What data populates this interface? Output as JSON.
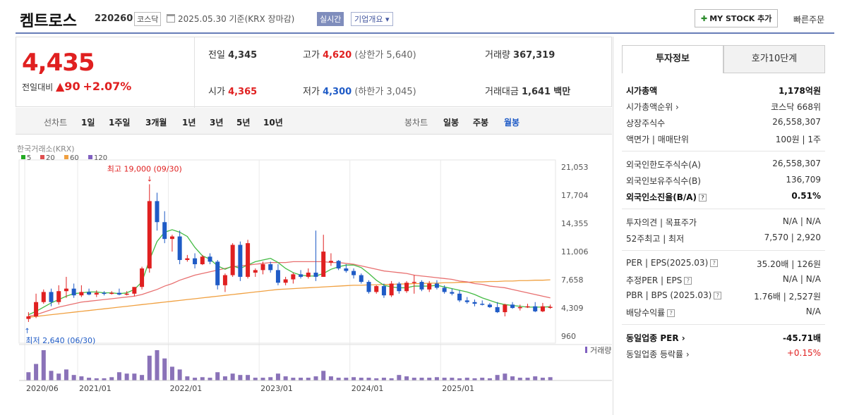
{
  "header": {
    "name": "켐트로스",
    "code": "220260",
    "market": "코스닥",
    "date_text": "2025.05.30 기준(KRX 장마감)",
    "live_label": "실시간",
    "info_label": "기업개요 ▾",
    "mystock_label": "MY STOCK 추가",
    "quick_label": "빠른주문"
  },
  "price": {
    "current": "4,435",
    "change_label": "전일대비",
    "change_value": "▲90",
    "change_pct": "+2.07%"
  },
  "quote": {
    "prev_label": "전일",
    "prev": "4,345",
    "high_label": "고가",
    "high": "4,620",
    "upper_limit": "(상한가 5,640)",
    "volume_label": "거래량",
    "volume": "367,319",
    "open_label": "시가",
    "open": "4,365",
    "low_label": "저가",
    "low": "4,300",
    "lower_limit": "(하한가 3,045)",
    "amount_label": "거래대금",
    "amount": "1,641",
    "amount_unit": "백만"
  },
  "rangebar": {
    "line_label": "선차트",
    "line_options": [
      "1일",
      "1주일",
      "3개월",
      "1년",
      "3년",
      "5년",
      "10년"
    ],
    "candle_label": "봉차트",
    "candle_options": [
      "일봉",
      "주봉",
      "월봉"
    ],
    "active_candle": "월봉"
  },
  "chart_data": {
    "type": "candlestick",
    "source": "한국거래소(KRX)",
    "legend": [
      {
        "name": "5",
        "color": "#22aa22"
      },
      {
        "name": "20",
        "color": "#e05050"
      },
      {
        "name": "60",
        "color": "#f0a040"
      },
      {
        "name": "120",
        "color": "#8060c0"
      }
    ],
    "y_ticks": [
      "21,053",
      "17,704",
      "14,355",
      "11,006",
      "7,658",
      "4,309",
      "960"
    ],
    "ylim": [
      960,
      21053
    ],
    "x_ticks": [
      "2020/06",
      "2021/01",
      "2022/01",
      "2023/01",
      "2024/01",
      "2025/01"
    ],
    "max_annotation": "최고 19,000 (09/30)",
    "min_annotation": "최저 2,640 (06/30)",
    "volume_label": "거래량",
    "candles": [
      [
        3000,
        2640,
        3800,
        3300
      ],
      [
        3300,
        3100,
        6000,
        5000
      ],
      [
        5000,
        4800,
        6500,
        6200
      ],
      [
        6200,
        4500,
        6600,
        5000
      ],
      [
        5000,
        4700,
        7000,
        6300
      ],
      [
        6300,
        5500,
        8000,
        6600
      ],
      [
        6600,
        5500,
        7200,
        5800
      ],
      [
        5800,
        5600,
        7000,
        6200
      ],
      [
        6200,
        5800,
        6600,
        5900
      ],
      [
        5900,
        5600,
        6400,
        6100
      ],
      [
        6100,
        5800,
        6300,
        6000
      ],
      [
        6000,
        5900,
        6300,
        6100
      ],
      [
        6100,
        5800,
        6600,
        5900
      ],
      [
        5900,
        5800,
        6300,
        6000
      ],
      [
        6000,
        5700,
        6500,
        6800
      ],
      [
        6800,
        6500,
        9200,
        9000
      ],
      [
        9000,
        8500,
        19000,
        17000
      ],
      [
        17000,
        13500,
        18000,
        14500
      ],
      [
        14500,
        12000,
        15800,
        12500
      ],
      [
        12500,
        11000,
        13000,
        12800
      ],
      [
        12800,
        9500,
        13500,
        10000
      ],
      [
        10000,
        9800,
        10600,
        10200
      ],
      [
        10200,
        9000,
        10800,
        9500
      ],
      [
        9500,
        9400,
        10600,
        10400
      ],
      [
        10400,
        9500,
        10800,
        9800
      ],
      [
        9800,
        6500,
        10000,
        7000
      ],
      [
        7000,
        6200,
        8400,
        8200
      ],
      [
        8200,
        8000,
        12000,
        11800
      ],
      [
        11800,
        7500,
        12200,
        8000
      ],
      [
        8000,
        7800,
        12400,
        12000
      ],
      [
        8500,
        8000,
        9000,
        8800
      ],
      [
        8800,
        8300,
        9800,
        9500
      ],
      [
        9500,
        8500,
        9800,
        8800
      ],
      [
        8800,
        7000,
        9500,
        7300
      ],
      [
        7300,
        7000,
        8000,
        7700
      ],
      [
        7700,
        7200,
        8500,
        8300
      ],
      [
        8300,
        7800,
        8800,
        8000
      ],
      [
        8000,
        7800,
        9000,
        8500
      ],
      [
        8500,
        7500,
        13500,
        8000
      ],
      [
        8000,
        8000,
        13000,
        11000
      ],
      [
        9700,
        9300,
        10800,
        9900
      ],
      [
        9900,
        8800,
        10000,
        9000
      ],
      [
        9000,
        8500,
        9500,
        8700
      ],
      [
        8700,
        7800,
        9000,
        8200
      ],
      [
        8200,
        7200,
        8400,
        7400
      ],
      [
        7400,
        6000,
        7600,
        6200
      ],
      [
        6200,
        6000,
        7000,
        6900
      ],
      [
        6900,
        5500,
        7200,
        5800
      ],
      [
        5800,
        5600,
        7500,
        7200
      ],
      [
        7200,
        6000,
        7400,
        6300
      ],
      [
        6300,
        6100,
        7500,
        7300
      ],
      [
        7300,
        6000,
        8200,
        7400
      ],
      [
        7400,
        6300,
        7600,
        6500
      ],
      [
        6500,
        6200,
        7500,
        7200
      ],
      [
        7200,
        6500,
        7600,
        6700
      ],
      [
        6700,
        6000,
        7000,
        6200
      ],
      [
        6200,
        5800,
        6600,
        6000
      ],
      [
        6000,
        5000,
        6400,
        5200
      ],
      [
        5200,
        4800,
        5600,
        5000
      ],
      [
        5000,
        4500,
        5300,
        4800
      ],
      [
        4800,
        4600,
        5200,
        4700
      ],
      [
        4700,
        4300,
        4900,
        4400
      ],
      [
        4400,
        3700,
        5000,
        3800
      ],
      [
        3800,
        3300,
        4800,
        4700
      ],
      [
        4700,
        4200,
        5000,
        4300
      ],
      [
        4300,
        4000,
        4700,
        4400
      ],
      [
        4400,
        4300,
        4800,
        4500
      ],
      [
        4500,
        3800,
        5000,
        3900
      ],
      [
        3900,
        3800,
        4900,
        4500
      ],
      [
        4400,
        4200,
        4700,
        4435
      ]
    ],
    "ma5": [
      3500,
      3900,
      4400,
      4900,
      5300,
      5700,
      6000,
      6100,
      6200,
      6200,
      6100,
      6100,
      6000,
      6100,
      6500,
      7400,
      10000,
      12200,
      13300,
      13600,
      13300,
      12800,
      11500,
      10500,
      10100,
      9300,
      8900,
      9300,
      9000,
      9400,
      9800,
      10000,
      10200,
      9700,
      9000,
      8500,
      8200,
      8100,
      8100,
      8400,
      8900,
      9200,
      9400,
      9400,
      9100,
      8400,
      7600,
      7000,
      6800,
      6700,
      6700,
      6900,
      6900,
      6900,
      7000,
      6800,
      6600,
      6400,
      6200,
      5900,
      5500,
      5200,
      4900,
      4700,
      4600,
      4500,
      4400,
      4400,
      4400,
      4450
    ],
    "ma20": [
      3300,
      3500,
      3800,
      4100,
      4400,
      4600,
      4800,
      5000,
      5100,
      5200,
      5300,
      5400,
      5500,
      5600,
      5700,
      5900,
      6200,
      6500,
      6900,
      7200,
      7600,
      7900,
      8200,
      8400,
      8600,
      8800,
      9000,
      9200,
      9300,
      9400,
      9500,
      9600,
      9700,
      9700,
      9700,
      9800,
      9800,
      9800,
      9800,
      9800,
      9700,
      9700,
      9600,
      9500,
      9300,
      9100,
      8900,
      8700,
      8600,
      8500,
      8400,
      8200,
      8100,
      8000,
      7900,
      7800,
      7700,
      7500,
      7400,
      7200,
      7100,
      6900,
      6800,
      6700,
      6500,
      6300,
      6100,
      5900,
      5700,
      5500
    ],
    "ma60": [
      3200,
      3300,
      3400,
      3500,
      3600,
      3700,
      3800,
      3900,
      4000,
      4100,
      4200,
      4300,
      4400,
      4500,
      4600,
      4700,
      4800,
      4900,
      5000,
      5100,
      5200,
      5300,
      5400,
      5500,
      5600,
      5700,
      5800,
      5900,
      6000,
      6100,
      6200,
      6300,
      6400,
      6500,
      6550,
      6600,
      6650,
      6700,
      6750,
      6800,
      6850,
      6900,
      6950,
      7000,
      7000,
      7050,
      7050,
      7100,
      7100,
      7150,
      7150,
      7200,
      7200,
      7250,
      7250,
      7300,
      7300,
      7350,
      7350,
      7400,
      7400,
      7450,
      7450,
      7500,
      7500,
      7550,
      7550,
      7600,
      7600,
      7650
    ],
    "volume": [
      30,
      60,
      110,
      35,
      25,
      40,
      20,
      15,
      10,
      8,
      8,
      12,
      30,
      25,
      25,
      20,
      90,
      110,
      80,
      50,
      40,
      15,
      10,
      12,
      10,
      30,
      15,
      25,
      20,
      20,
      10,
      10,
      12,
      25,
      15,
      10,
      10,
      10,
      15,
      35,
      15,
      10,
      10,
      12,
      10,
      10,
      8,
      10,
      8,
      20,
      15,
      10,
      10,
      10,
      12,
      10,
      10,
      8,
      10,
      8,
      10,
      8,
      20,
      25,
      15,
      10,
      10,
      15,
      10,
      12
    ]
  },
  "side": {
    "tab_active": "투자정보",
    "tab_other": "호가10단계",
    "rows_a": [
      {
        "k": "시가총액",
        "v": "1,178억원",
        "bold": true
      },
      {
        "k": "시가총액순위 ›",
        "v": "코스닥 668위"
      },
      {
        "k": "상장주식수",
        "v": "26,558,307"
      },
      {
        "k": "액면가 | 매매단위",
        "v": "100원 | 1주"
      }
    ],
    "rows_b": [
      {
        "k": "외국인한도주식수(A)",
        "v": "26,558,307"
      },
      {
        "k": "외국인보유주식수(B)",
        "v": "136,709"
      },
      {
        "k": "외국인소진율(B/A)",
        "v": "0.51%",
        "bold": true,
        "q": true
      }
    ],
    "rows_c": [
      {
        "k": "투자의견 | 목표주가",
        "v": "N/A | N/A"
      },
      {
        "k": "52주최고 | 최저",
        "v": "7,570 | 2,920"
      }
    ],
    "rows_d": [
      {
        "k": "PER | EPS(2025.03)",
        "v": "35.20배 | 126원",
        "q": true
      },
      {
        "k": "추정PER | EPS",
        "v": "N/A | N/A",
        "q": true
      },
      {
        "k": "PBR | BPS (2025.03)",
        "v": "1.76배 | 2,527원",
        "q": true
      },
      {
        "k": "배당수익률",
        "v": "N/A",
        "q": true
      }
    ],
    "rows_e": [
      {
        "k": "동일업종 PER ›",
        "v": "-45.71배",
        "bold": true
      },
      {
        "k": "동일업종 등락률 ›",
        "v": "+0.15%",
        "red": true
      }
    ]
  }
}
